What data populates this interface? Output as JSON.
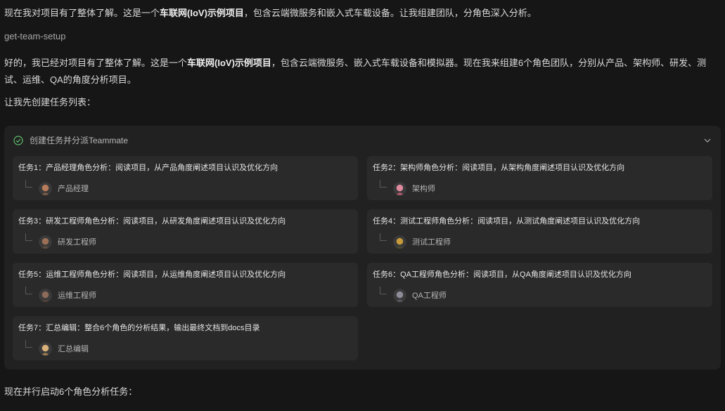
{
  "messages": {
    "intro": [
      "现在我对项目有了整体了解。这是一个",
      "车联网(IoV)示例项目",
      "，包含云端微服务和嵌入式车载设备。让我组建团队，分角色深入分析。"
    ],
    "tool_call": "get-team-setup",
    "team_plan": [
      "好的，我已经对项目有了整体了解。这是一个",
      "车联网(IoV)示例项目",
      "，包含云端微服务、嵌入式车载设备和模拟器。现在我来组建6个角色团队，分别从产品、架构师、研发、测试、运维、QA的角度分析项目。"
    ],
    "create_list": "让我先创建任务列表：",
    "launch": "现在并行启动6个角色分析任务："
  },
  "task_panel": {
    "title": "创建任务并分派Teammate",
    "status": "completed",
    "tasks": [
      {
        "title": "任务1：产品经理角色分析：阅读项目，从产品角度阐述项目认识及优化方向",
        "assignee": "产品经理",
        "avatar_color": "#b67c5b"
      },
      {
        "title": "任务2：架构师角色分析：阅读项目，从架构角度阐述项目认识及优化方向",
        "assignee": "架构师",
        "avatar_color": "#e08aa0"
      },
      {
        "title": "任务3：研发工程师角色分析：阅读项目，从研发角度阐述项目认识及优化方向",
        "assignee": "研发工程师",
        "avatar_color": "#9a6f55"
      },
      {
        "title": "任务4：测试工程师角色分析：阅读项目，从测试角度阐述项目认识及优化方向",
        "assignee": "测试工程师",
        "avatar_color": "#c79a3a"
      },
      {
        "title": "任务5：运维工程师角色分析：阅读项目，从运维角度阐述项目认识及优化方向",
        "assignee": "运维工程师",
        "avatar_color": "#8c6b5a"
      },
      {
        "title": "任务6：QA工程师角色分析：阅读项目，从QA角度阐述项目认识及优化方向",
        "assignee": "QA工程师",
        "avatar_color": "#8d8d99"
      },
      {
        "title": "任务7：汇总编辑：整合6个角色的分析结果，输出最终文档到docs目录",
        "assignee": "汇总编辑",
        "avatar_color": "#d8b07a"
      }
    ]
  },
  "colors": {
    "check": "#5fbf6a",
    "background": "#161616",
    "panel": "#212121",
    "card": "#2a2a2a"
  }
}
